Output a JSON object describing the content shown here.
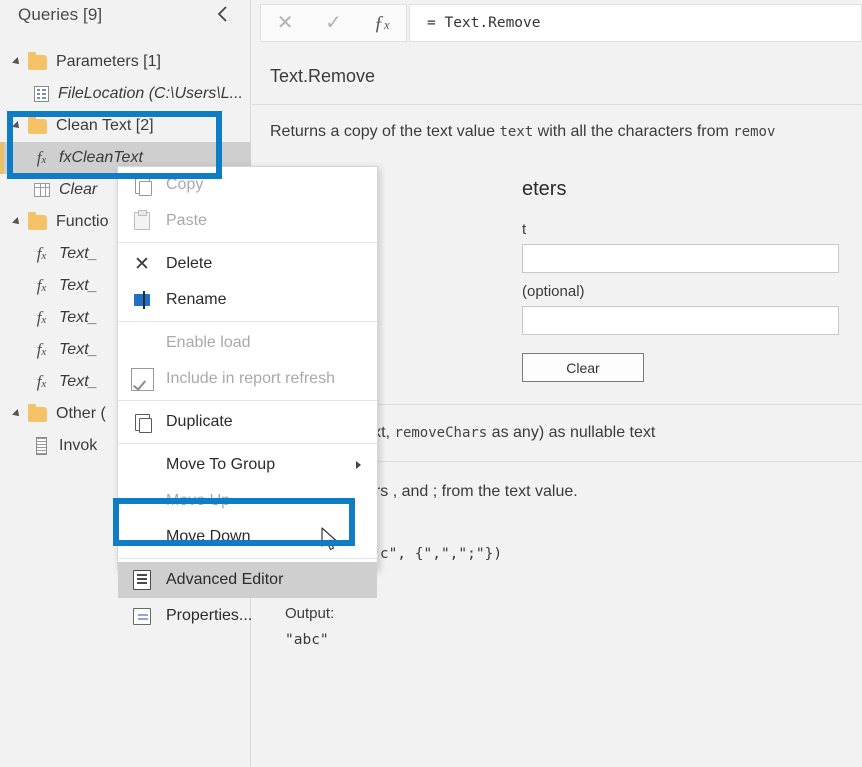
{
  "sidebar": {
    "title": "Queries [9]",
    "collapse_icon": "chevron-left-icon",
    "items": [
      {
        "label": "Parameters [1]",
        "icon": "folder-icon",
        "type": "group",
        "indent": 0,
        "expanded": true
      },
      {
        "label": "FileLocation (C:\\Users\\L...",
        "icon": "parameter-icon",
        "type": "parameter",
        "indent": 1,
        "italic": true
      },
      {
        "label": "Clean Text [2]",
        "icon": "folder-icon",
        "type": "group",
        "indent": 0,
        "expanded": true
      },
      {
        "label": "fxCleanText",
        "icon": "fx-icon",
        "type": "function",
        "indent": 1,
        "italic": true,
        "selected": true
      },
      {
        "label": "Clear",
        "icon": "table-icon",
        "type": "table",
        "indent": 1,
        "italic": true
      },
      {
        "label": "Functio",
        "icon": "folder-icon",
        "type": "group",
        "indent": 0,
        "expanded": true
      },
      {
        "label": "Text_",
        "icon": "fx-icon",
        "type": "function",
        "indent": 1,
        "italic": true
      },
      {
        "label": "Text_",
        "icon": "fx-icon",
        "type": "function",
        "indent": 1,
        "italic": true
      },
      {
        "label": "Text_",
        "icon": "fx-icon",
        "type": "function",
        "indent": 1,
        "italic": true
      },
      {
        "label": "Text_",
        "icon": "fx-icon",
        "type": "function",
        "indent": 1,
        "italic": true
      },
      {
        "label": "Text_",
        "icon": "fx-icon",
        "type": "function",
        "indent": 1,
        "italic": true
      },
      {
        "label": "Other (",
        "icon": "folder-icon",
        "type": "group",
        "indent": 0,
        "expanded": true
      },
      {
        "label": "Invok",
        "icon": "list-icon",
        "type": "query",
        "indent": 1
      }
    ]
  },
  "context_menu": {
    "items": [
      {
        "label": "Copy",
        "icon": "copy-icon",
        "disabled": false,
        "highlighted": false,
        "submenu": false
      },
      {
        "label": "Paste",
        "icon": "paste-icon",
        "disabled": true,
        "highlighted": false,
        "submenu": false
      },
      {
        "separator_after": true,
        "label": "",
        "icon": "",
        "disabled": false,
        "highlighted": false,
        "submenu": false
      },
      {
        "label": "Delete",
        "icon": "delete-x-icon",
        "disabled": false,
        "highlighted": false,
        "submenu": false
      },
      {
        "label": "Rename",
        "icon": "rename-icon",
        "disabled": false,
        "highlighted": false,
        "submenu": false
      },
      {
        "separator_after": true,
        "label": "",
        "icon": "",
        "disabled": false,
        "highlighted": false,
        "submenu": false
      },
      {
        "label": "Enable load",
        "icon": "",
        "disabled": true,
        "highlighted": false,
        "submenu": false
      },
      {
        "label": "Include in report refresh",
        "icon": "checkbox-checked-icon",
        "disabled": true,
        "highlighted": false,
        "submenu": false
      },
      {
        "separator_after": true,
        "label": "",
        "icon": "",
        "disabled": false,
        "highlighted": false,
        "submenu": false
      },
      {
        "label": "Duplicate",
        "icon": "duplicate-icon",
        "disabled": false,
        "highlighted": false,
        "submenu": false
      },
      {
        "separator_after": true,
        "label": "",
        "icon": "",
        "disabled": false,
        "highlighted": false,
        "submenu": false
      },
      {
        "label": "Move To Group",
        "icon": "",
        "disabled": false,
        "highlighted": false,
        "submenu": true
      },
      {
        "label": "Move Up",
        "icon": "",
        "disabled": true,
        "highlighted": false,
        "submenu": false
      },
      {
        "label": "Move Down",
        "icon": "",
        "disabled": false,
        "highlighted": false,
        "submenu": false
      },
      {
        "separator_after": true,
        "label": "",
        "icon": "",
        "disabled": false,
        "highlighted": false,
        "submenu": false
      },
      {
        "label": "Advanced Editor",
        "icon": "advanced-editor-icon",
        "disabled": false,
        "highlighted": true,
        "submenu": false
      },
      {
        "label": "Properties...",
        "icon": "properties-icon",
        "disabled": false,
        "highlighted": false,
        "submenu": false
      }
    ]
  },
  "formula_bar": {
    "cancel_icon": "close-x-icon",
    "accept_icon": "checkmark-icon",
    "fx_icon": "fx-icon",
    "value": "= Text.Remove"
  },
  "main": {
    "function_title": "Text.Remove",
    "description_prefix": "Returns a copy of the text value ",
    "description_mono1": "text",
    "description_mid": " with all the characters from ",
    "description_mono2": "remov",
    "enter_parameters_title": "eters",
    "param1_label": "t",
    "param1_value": "",
    "param2_label": "(optional)",
    "param2_value": "",
    "clear_button": "Clear",
    "signature": "t as nullable text, removeChars as any) as nullable text",
    "signature_mono": "removeChars",
    "example_description": "move characters , and ; from the text value.",
    "example_code": "ve(\"a,b;c\", {\",\",\";\"})",
    "output_label": "Output:",
    "output_value": "\"abc\""
  },
  "colors": {
    "callout_blue": "#0f7cc6",
    "folder_orange": "#f5c268",
    "selection_gray": "#cfcfcf",
    "panel_bg": "#f2f2f2"
  }
}
